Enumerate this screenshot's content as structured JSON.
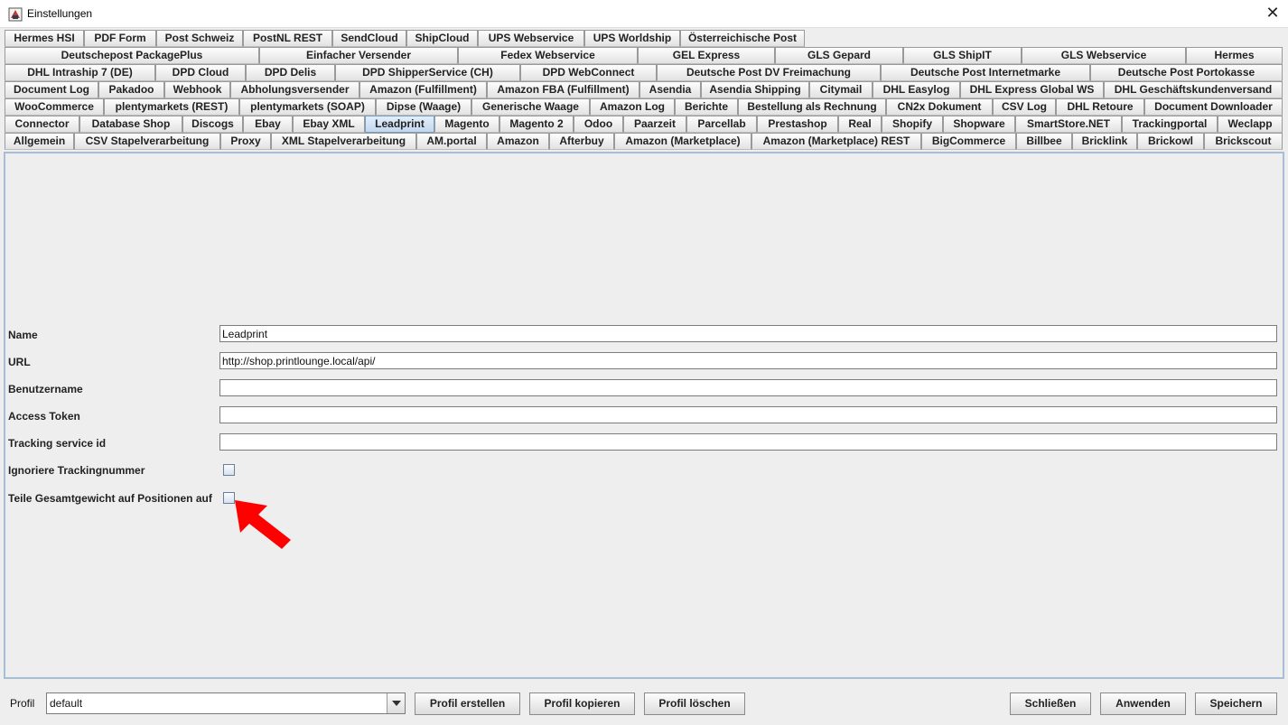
{
  "window": {
    "title": "Einstellungen",
    "close_glyph": "✕",
    "icon": "app-icon"
  },
  "tabs": {
    "active": "Leadprint",
    "rows": [
      [
        "Hermes HSI",
        "PDF Form",
        "Post Schweiz",
        "PostNL REST",
        "SendCloud",
        "ShipCloud",
        "UPS Webservice",
        "UPS Worldship",
        "Österreichische Post"
      ],
      [
        "Deutschepost PackagePlus",
        "Einfacher Versender",
        "Fedex Webservice",
        "GEL Express",
        "GLS Gepard",
        "GLS ShipIT",
        "GLS Webservice",
        "Hermes"
      ],
      [
        "DHL Intraship 7 (DE)",
        "DPD Cloud",
        "DPD Delis",
        "DPD ShipperService (CH)",
        "DPD WebConnect",
        "Deutsche Post DV Freimachung",
        "Deutsche Post Internetmarke",
        "Deutsche Post Portokasse"
      ],
      [
        "Document Log",
        "Pakadoo",
        "Webhook",
        "Abholungsversender",
        "Amazon (Fulfillment)",
        "Amazon FBA (Fulfillment)",
        "Asendia",
        "Asendia Shipping",
        "Citymail",
        "DHL Easylog",
        "DHL Express Global WS",
        "DHL Geschäftskundenversand"
      ],
      [
        "WooCommerce",
        "plentymarkets (REST)",
        "plentymarkets (SOAP)",
        "Dipse (Waage)",
        "Generische Waage",
        "Amazon Log",
        "Berichte",
        "Bestellung als Rechnung",
        "CN2x Dokument",
        "CSV Log",
        "DHL Retoure",
        "Document Downloader"
      ],
      [
        "Connector",
        "Database Shop",
        "Discogs",
        "Ebay",
        "Ebay XML",
        "Leadprint",
        "Magento",
        "Magento 2",
        "Odoo",
        "Paarzeit",
        "Parcellab",
        "Prestashop",
        "Real",
        "Shopify",
        "Shopware",
        "SmartStore.NET",
        "Trackingportal",
        "Weclapp"
      ],
      [
        "Allgemein",
        "CSV Stapelverarbeitung",
        "Proxy",
        "XML Stapelverarbeitung",
        "AM.portal",
        "Amazon",
        "Afterbuy",
        "Amazon (Marketplace)",
        "Amazon (Marketplace) REST",
        "BigCommerce",
        "Billbee",
        "Bricklink",
        "Brickowl",
        "Brickscout"
      ]
    ]
  },
  "form": {
    "name_label": "Name",
    "name_value": "Leadprint",
    "url_label": "URL",
    "url_value": "http://shop.printlounge.local/api/",
    "username_label": "Benutzername",
    "username_value": "",
    "token_label": "Access Token",
    "token_value": "",
    "tracking_id_label": "Tracking service id",
    "tracking_id_value": "",
    "ignore_tracking_label": "Ignoriere Trackingnummer",
    "ignore_tracking_checked": false,
    "split_weight_label": "Teile Gesamtgewicht auf Positionen auf",
    "split_weight_checked": false
  },
  "annotation": {
    "icon": "red-arrow-icon",
    "color": "#ff0000"
  },
  "footer": {
    "profile_label": "Profil",
    "profile_value": "default",
    "create_label": "Profil erstellen",
    "copy_label": "Profil kopieren",
    "delete_label": "Profil löschen",
    "close_label": "Schließen",
    "apply_label": "Anwenden",
    "save_label": "Speichern"
  },
  "colors": {
    "active_tab": "#c3d7ee",
    "panel_border": "#a7bed6",
    "window_bg": "#eeeeee"
  }
}
